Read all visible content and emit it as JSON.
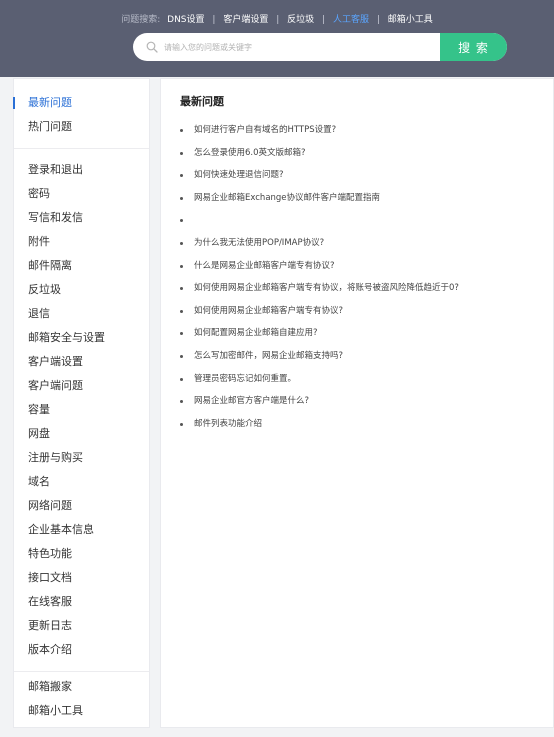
{
  "header": {
    "quick_label": "问题搜索:",
    "links": [
      {
        "label": "DNS设置",
        "active": false
      },
      {
        "label": "客户端设置",
        "active": false
      },
      {
        "label": "反垃圾",
        "active": false
      },
      {
        "label": "人工客服",
        "active": true
      },
      {
        "label": "邮箱小工具",
        "active": false
      }
    ],
    "separator": "|",
    "search": {
      "placeholder": "请输入您的问题或关键字",
      "value": "",
      "button_label": "搜 索",
      "icon": "search-icon"
    }
  },
  "sidebar": {
    "group1": [
      {
        "label": "最新问题",
        "active": true
      },
      {
        "label": "热门问题",
        "active": false
      }
    ],
    "group2": [
      {
        "label": "登录和退出"
      },
      {
        "label": "密码"
      },
      {
        "label": "写信和发信"
      },
      {
        "label": "附件"
      },
      {
        "label": "邮件隔离"
      },
      {
        "label": "反垃圾"
      },
      {
        "label": "退信"
      },
      {
        "label": "邮箱安全与设置"
      },
      {
        "label": "客户端设置"
      },
      {
        "label": "客户端问题"
      },
      {
        "label": "容量"
      },
      {
        "label": "网盘"
      },
      {
        "label": "注册与购买"
      },
      {
        "label": "域名"
      },
      {
        "label": "网络问题"
      },
      {
        "label": "企业基本信息"
      },
      {
        "label": "特色功能"
      },
      {
        "label": "接口文档"
      },
      {
        "label": "在线客服"
      },
      {
        "label": "更新日志"
      },
      {
        "label": "版本介绍"
      }
    ],
    "group3": [
      {
        "label": "邮箱搬家"
      },
      {
        "label": "邮箱小工具"
      }
    ]
  },
  "main": {
    "title": "最新问题",
    "questions": [
      "如何进行客户自有域名的HTTPS设置?",
      "怎么登录使用6.0英文版邮箱?",
      "如何快速处理退信问题?",
      "网易企业邮箱Exchange协议邮件客户端配置指南",
      "",
      "为什么我无法使用POP/IMAP协议?",
      "什么是网易企业邮箱客户端专有协议?",
      "如何使用网易企业邮箱客户端专有协议，将账号被盗风险降低趋近于0?",
      "如何使用网易企业邮箱客户端专有协议?",
      "如何配置网易企业邮箱自建应用?",
      "怎么写加密邮件，网易企业邮箱支持吗?",
      "管理员密码忘记如何重置。",
      "网易企业邮官方客户端是什么?",
      "邮件列表功能介绍"
    ]
  },
  "colors": {
    "header_bg": "#5a5f72",
    "accent_blue": "#2a6fd6",
    "active_link": "#5aa5ff",
    "search_button": "#35c38a"
  }
}
